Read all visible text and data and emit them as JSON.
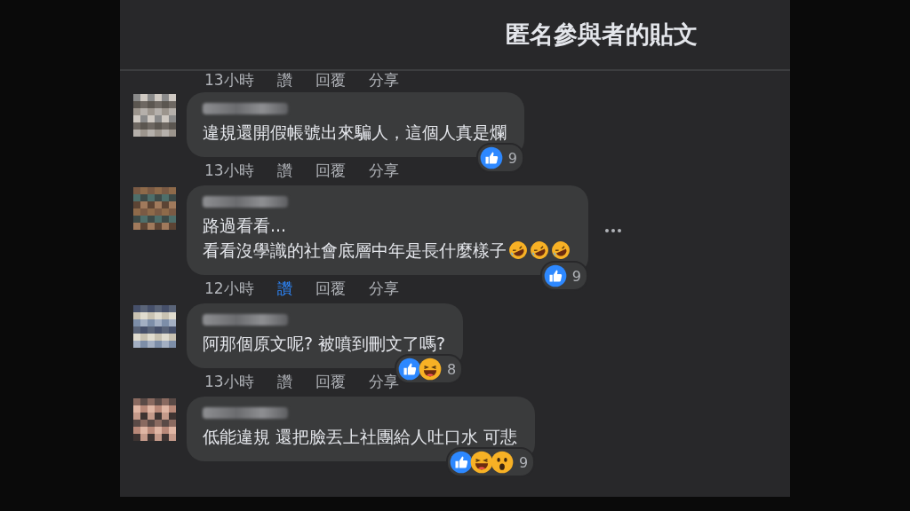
{
  "header": {
    "title": "匿名參與者的貼文"
  },
  "previous_actions": {
    "time": "13小時",
    "like_label": "讚",
    "liked": false,
    "reply": "回覆",
    "share": "分享"
  },
  "comments": [
    {
      "lines": [
        "違規還開假帳號出來騙人，這個人真是爛"
      ],
      "more": false,
      "reactions": [
        {
          "kind": "like"
        }
      ],
      "count": "9",
      "time": "13小時",
      "like_label": "讚",
      "liked": false,
      "reply": "回覆",
      "share": "分享"
    },
    {
      "lines": [
        "路過看看...",
        "看看沒學識的社會底層中年是長什麼樣子"
      ],
      "emojis": [
        {
          "kind": "rofl"
        },
        {
          "kind": "rofl"
        },
        {
          "kind": "rofl"
        }
      ],
      "more": true,
      "reactions": [
        {
          "kind": "like"
        }
      ],
      "count": "9",
      "time": "12小時",
      "like_label": "讚",
      "liked": true,
      "reply": "回覆",
      "share": "分享"
    },
    {
      "lines": [
        "阿那個原文呢? 被噴到刪文了嗎?"
      ],
      "more": false,
      "reactions": [
        {
          "kind": "like"
        },
        {
          "kind": "haha"
        }
      ],
      "count": "8",
      "time": "13小時",
      "like_label": "讚",
      "liked": false,
      "reply": "回覆",
      "share": "分享"
    },
    {
      "lines": [
        "低能違規 還把臉丟上社團給人吐口水 可悲"
      ],
      "more": false,
      "reactions": [
        {
          "kind": "like"
        },
        {
          "kind": "haha"
        },
        {
          "kind": "wow"
        }
      ],
      "count": "9"
    }
  ]
}
